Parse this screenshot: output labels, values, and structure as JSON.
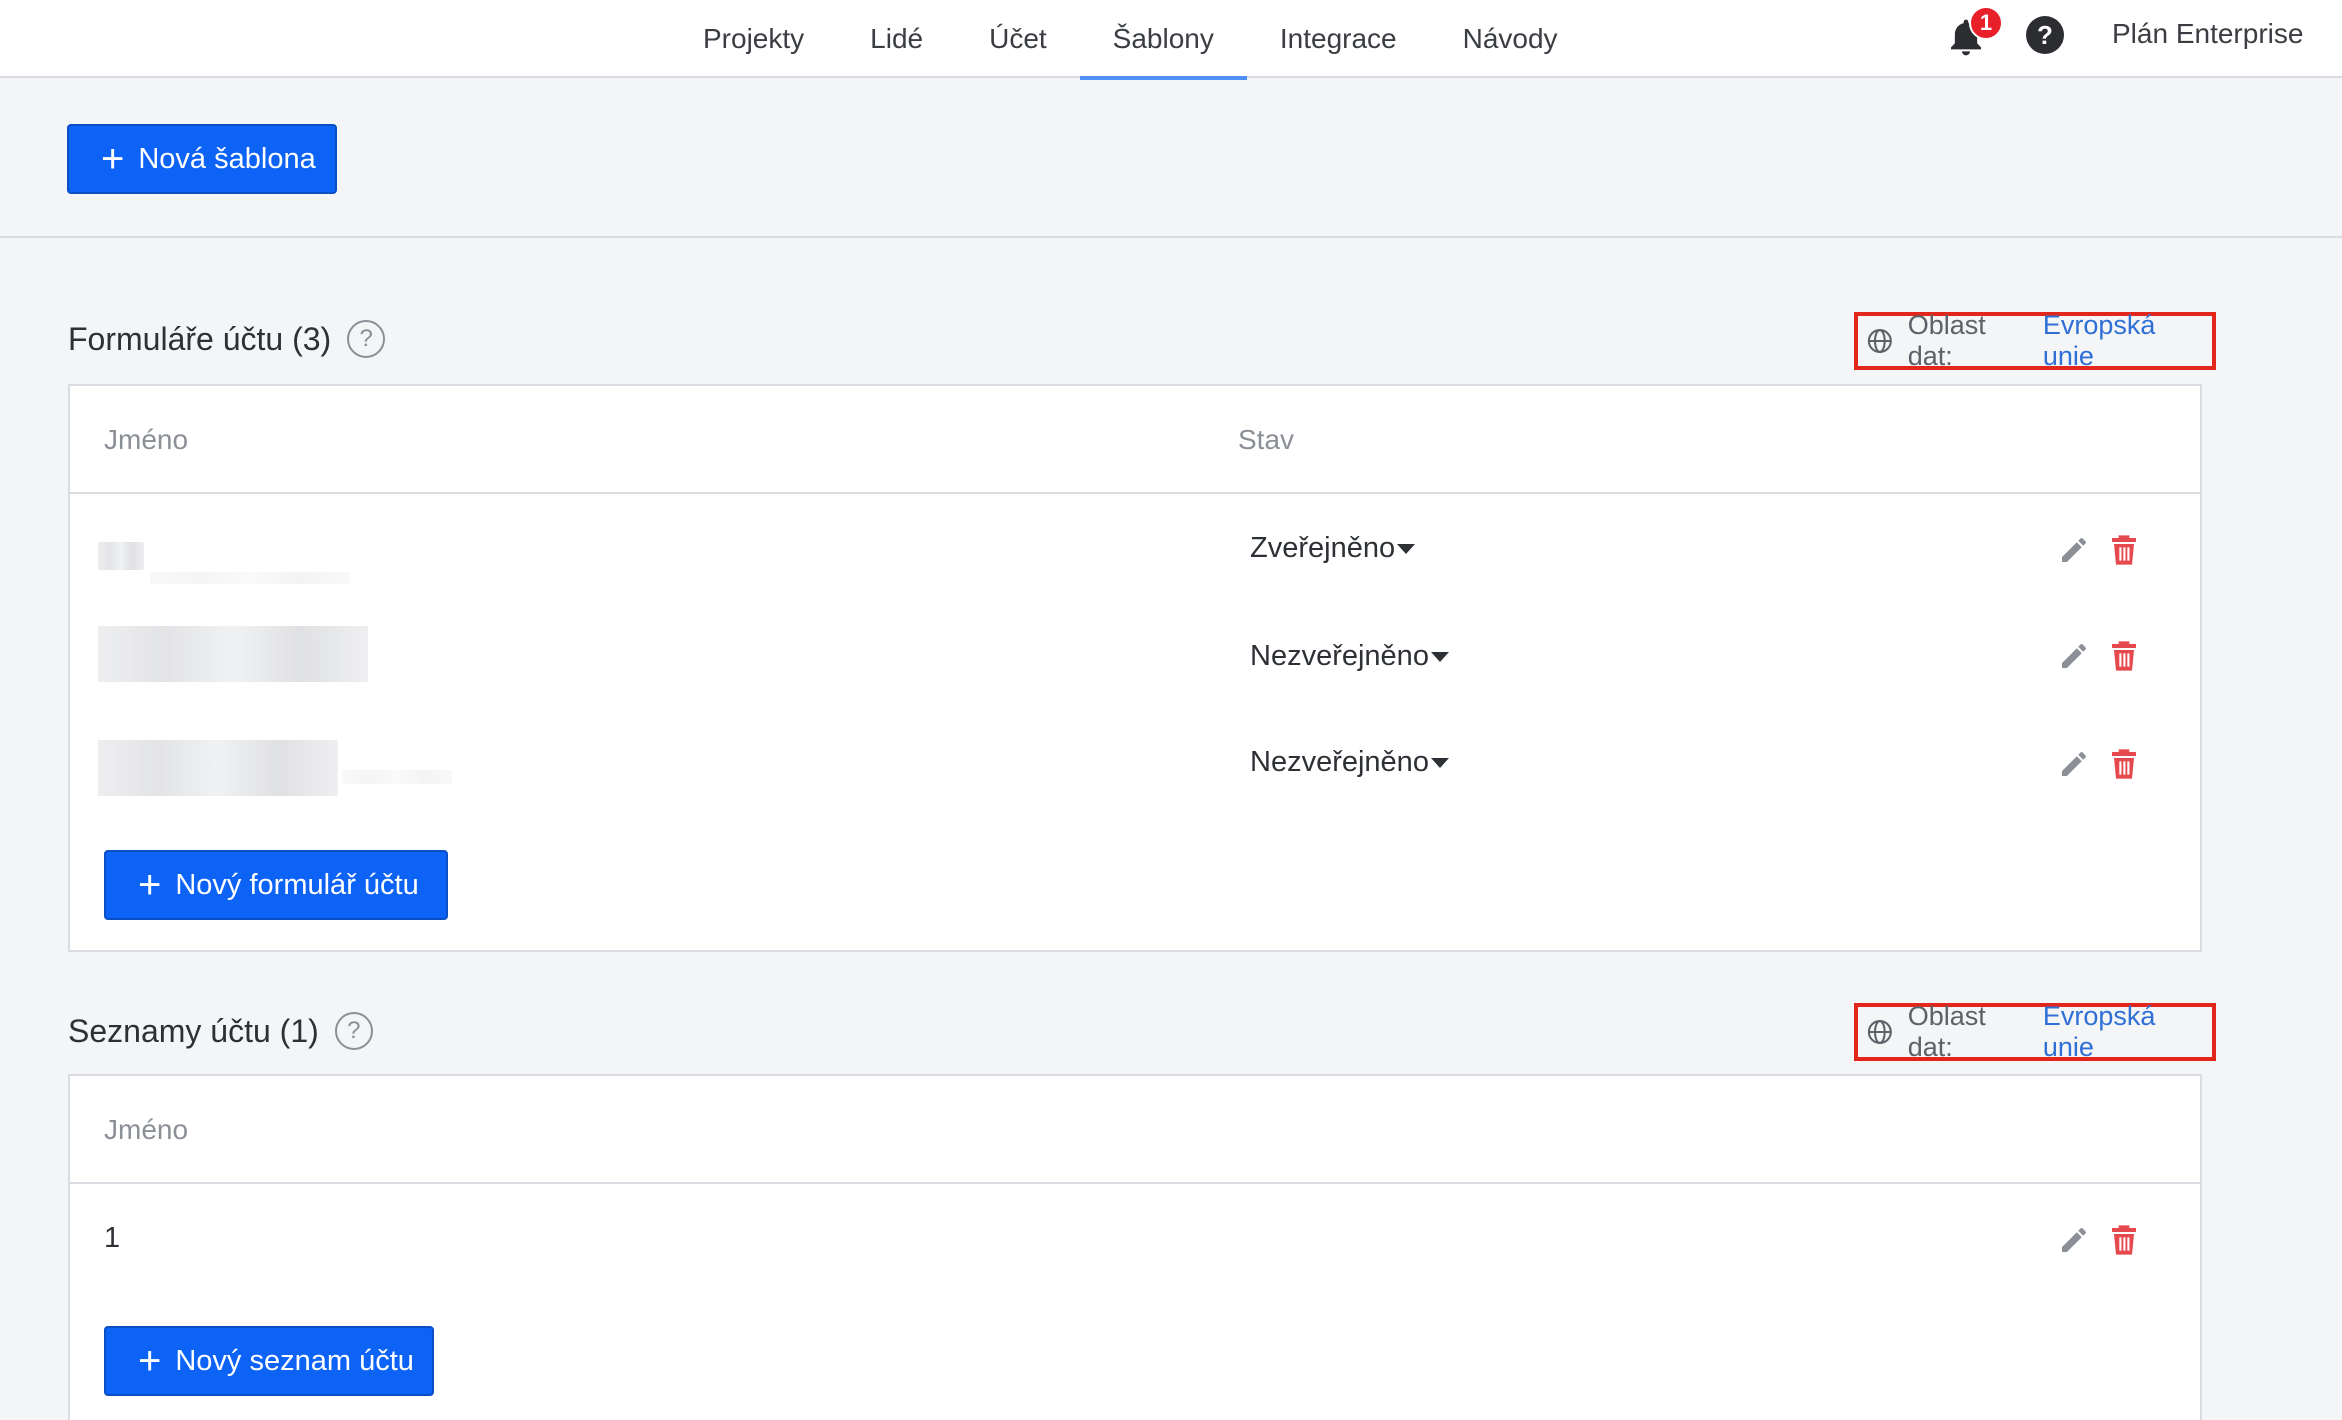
{
  "nav": {
    "items": [
      {
        "label": "Projekty",
        "active": false
      },
      {
        "label": "Lidé",
        "active": false
      },
      {
        "label": "Účet",
        "active": false
      },
      {
        "label": "Šablony",
        "active": true
      },
      {
        "label": "Integrace",
        "active": false
      },
      {
        "label": "Návody",
        "active": false
      }
    ],
    "notification_count": "1",
    "help_label": "?",
    "plan": "Plán Enterprise"
  },
  "toolbar": {
    "new_template_label": "Nová šablona"
  },
  "forms": {
    "title": "Formuláře účtu (3)",
    "help": "?",
    "region_label": "Oblast dat:",
    "region_value": "Evropská unie",
    "col_name": "Jméno",
    "col_status": "Stav",
    "rows": [
      {
        "name": "",
        "status": "Zveřejněno"
      },
      {
        "name": "",
        "status": "Nezveřejněno"
      },
      {
        "name": "",
        "status": "Nezveřejněno"
      }
    ],
    "new_label": "Nový formulář účtu"
  },
  "lists": {
    "title": "Seznamy účtu (1)",
    "help": "?",
    "region_label": "Oblast dat:",
    "region_value": "Evropská unie",
    "col_name": "Jméno",
    "rows": [
      {
        "name": "1"
      }
    ],
    "new_label": "Nový seznam účtu"
  },
  "colors": {
    "primary": "#0c63f5",
    "highlight": "#e3261b",
    "link": "#2f6fd6",
    "delete": "#e5484d",
    "badge": "#e8202a"
  }
}
